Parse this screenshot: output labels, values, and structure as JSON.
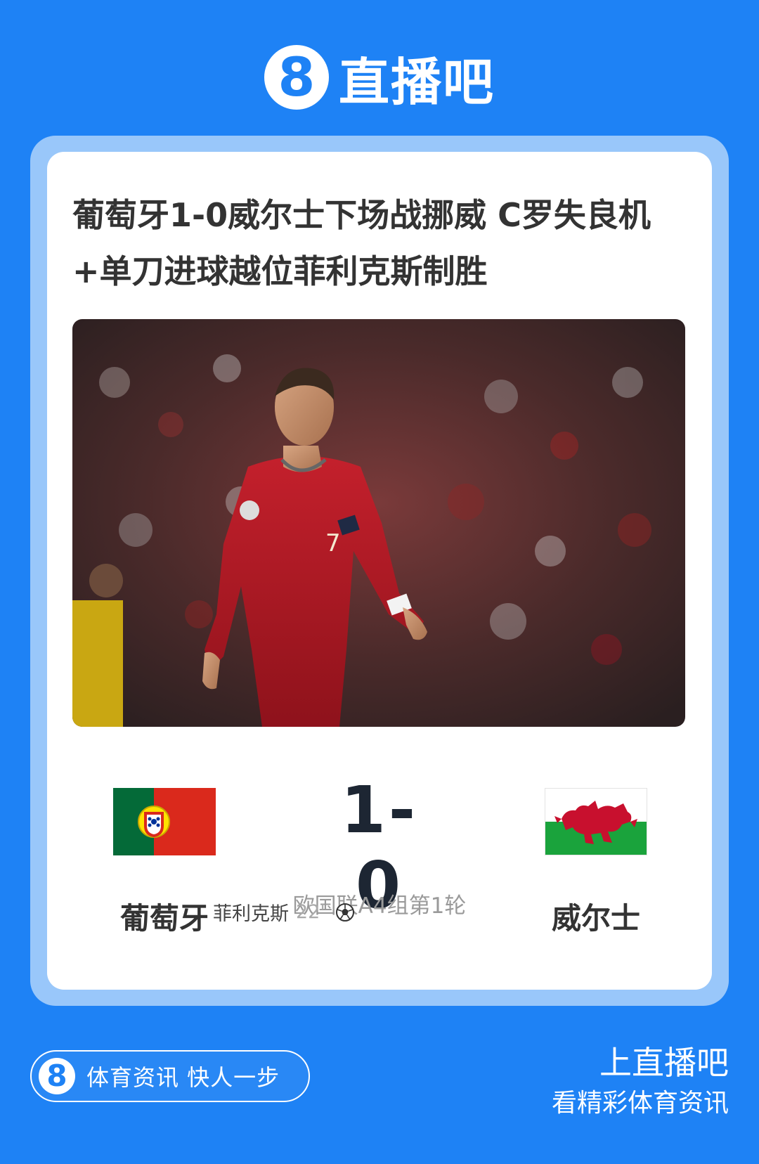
{
  "brand": {
    "logo_glyph": "8",
    "name": "直播吧",
    "color": "#1e82f5"
  },
  "article": {
    "title": "葡萄牙1-0威尔士下场战挪威 C罗失良机+单刀进球越位菲利克斯制胜",
    "image_alt": "C罗身穿葡萄牙7号红色球衣在球场上"
  },
  "match": {
    "home_team": "葡萄牙",
    "away_team": "威尔士",
    "home_score": "1",
    "score_separator": "-",
    "away_score": "0",
    "competition": "欧国联A4组第1轮",
    "home_flag": "portugal-flag-icon",
    "away_flag": "wales-flag-icon"
  },
  "scorers": [
    {
      "name": "菲利克斯",
      "minute": "22'",
      "icon": "soccer-ball-icon"
    }
  ],
  "footer": {
    "slogan": "体育资讯 快人一步",
    "cta_line1": "上直播吧",
    "cta_line2": "看精彩体育资讯"
  }
}
